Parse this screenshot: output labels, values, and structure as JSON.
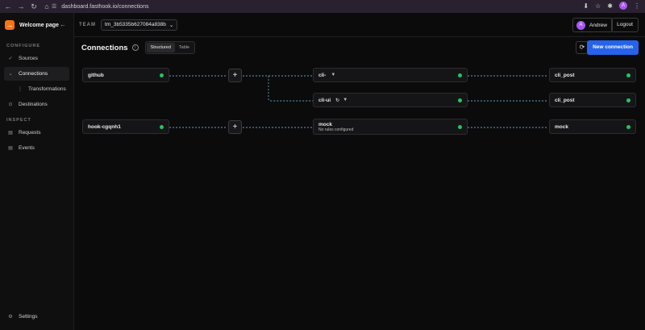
{
  "browser": {
    "url": "dashboard.fasthook.io/connections",
    "profile_initial": "A"
  },
  "sidebar": {
    "brand_title": "Welcome page",
    "sections": [
      {
        "label": "CONFIGURE"
      },
      {
        "label": "INSPECT"
      }
    ],
    "items": [
      {
        "label": "Sources",
        "icon": "check-icon"
      },
      {
        "label": "Connections",
        "icon": "chevron-down-icon"
      },
      {
        "label": "Transformations",
        "icon": "dots-icon"
      },
      {
        "label": "Destinations",
        "icon": "circle-icon"
      },
      {
        "label": "Requests",
        "icon": "list-icon"
      },
      {
        "label": "Events",
        "icon": "list-icon"
      }
    ],
    "settings_label": "Settings"
  },
  "topbar": {
    "team_label": "TEAM",
    "team_value": "tm_3b5335b627084a838b",
    "user_name": "Andrew",
    "user_initial": "A",
    "logout_label": "Logout"
  },
  "header": {
    "title": "Connections",
    "toggle_structured": "Structured",
    "toggle_table": "Table",
    "new_connection_label": "New connection"
  },
  "canvas": {
    "sources": [
      {
        "name": "github"
      },
      {
        "name": "hook-cgqnh1"
      }
    ],
    "connections": [
      {
        "name": "cli-",
        "subtitle": ""
      },
      {
        "name": "cli-ui",
        "subtitle": ""
      },
      {
        "name": "mock",
        "subtitle": "No rules configured"
      }
    ],
    "destinations": [
      {
        "name": "cli_post"
      },
      {
        "name": "cli_post"
      },
      {
        "name": "mock"
      }
    ],
    "status_color": "#22c55e",
    "edge_color": "#7dd3fc"
  },
  "colors": {
    "accent": "#2563eb",
    "brand": "#f97316",
    "avatar": "#a855f7"
  }
}
